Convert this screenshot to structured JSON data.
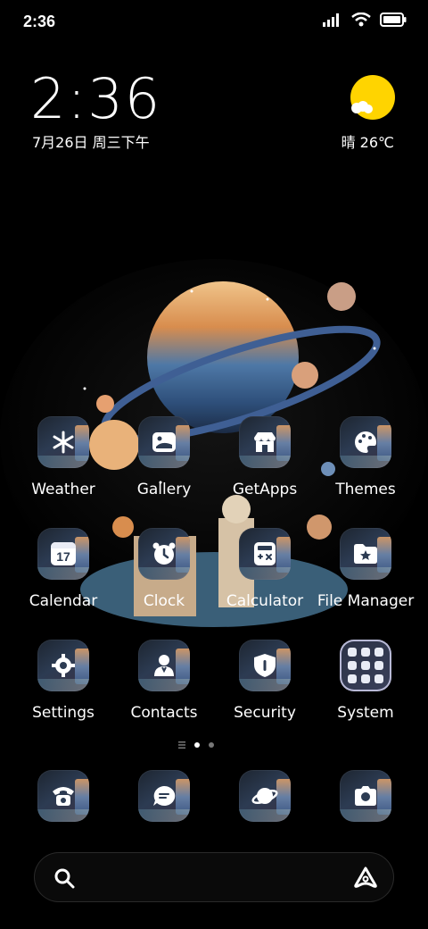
{
  "status_bar": {
    "time": "2:36"
  },
  "clock_widget": {
    "time": "2:36",
    "date": "7月26日 周三下午"
  },
  "weather_widget": {
    "text": "晴 26℃"
  },
  "apps": [
    {
      "label": "Weather",
      "icon": "snowflake-icon"
    },
    {
      "label": "Gallery",
      "icon": "image-icon"
    },
    {
      "label": "GetApps",
      "icon": "store-icon"
    },
    {
      "label": "Themes",
      "icon": "palette-icon"
    },
    {
      "label": "Calendar",
      "icon": "calendar-icon",
      "badge": "17"
    },
    {
      "label": "Clock",
      "icon": "alarm-clock-icon"
    },
    {
      "label": "Calculator",
      "icon": "calculator-icon"
    },
    {
      "label": "File Manager",
      "icon": "folder-star-icon"
    },
    {
      "label": "Settings",
      "icon": "gear-icon"
    },
    {
      "label": "Contacts",
      "icon": "contacts-icon"
    },
    {
      "label": "Security",
      "icon": "shield-icon"
    },
    {
      "label": "System",
      "icon": "folder-grid-icon"
    }
  ],
  "page_indicator": {
    "pages": 2,
    "active": 0
  },
  "dock": [
    {
      "icon": "phone-icon"
    },
    {
      "icon": "message-icon"
    },
    {
      "icon": "browser-planet-icon"
    },
    {
      "icon": "camera-icon"
    }
  ],
  "colors": {
    "sun": "#ffd400",
    "background": "#000000"
  }
}
